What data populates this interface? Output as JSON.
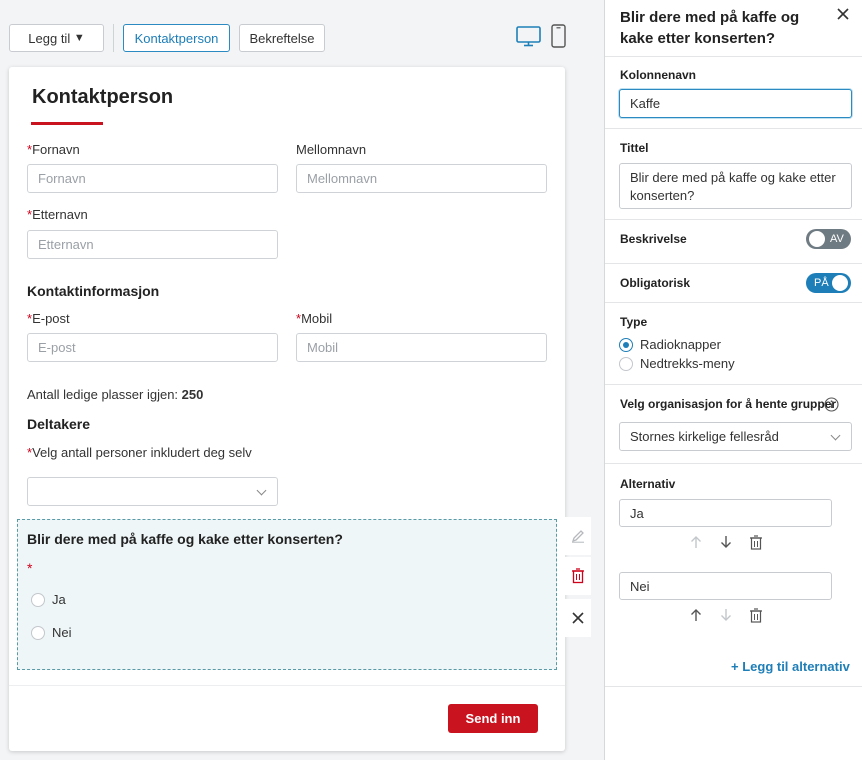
{
  "toolbar": {
    "add_label": "Legg til",
    "add_caret": "▼",
    "tab_contact": "Kontaktperson",
    "tab_confirm": "Bekreftelse",
    "desktop_icon": "desktop-icon",
    "mobile_icon": "mobile-icon"
  },
  "form": {
    "title": "Kontaktperson",
    "required_mark": "*",
    "firstname_label": "Fornavn",
    "firstname_placeholder": "Fornavn",
    "middlename_label": "Mellomnavn",
    "middlename_placeholder": "Mellomnavn",
    "lastname_label": "Etternavn",
    "lastname_placeholder": "Etternavn",
    "contact_section": "Kontaktinformasjon",
    "email_label": "E-post",
    "email_placeholder": "E-post",
    "mobile_label": "Mobil",
    "mobile_placeholder": "Mobil",
    "seats_label": "Antall ledige plasser igjen:",
    "seats_value": "250",
    "participants_section": "Deltakere",
    "participants_label": "Velg antall personer inkludert deg selv",
    "question": "Blir dere med på kaffe og kake etter konserten?",
    "options": [
      "Ja",
      "Nei"
    ],
    "submit": "Send inn"
  },
  "panel": {
    "title": "Blir dere med på kaffe og kake etter konserten?",
    "column_label": "Kolonnenavn",
    "column_value": "Kaffe",
    "title_label": "Tittel",
    "title_value": "Blir dere med på kaffe og kake etter konserten?",
    "description_label": "Beskrivelse",
    "description_toggle": "AV",
    "required_label": "Obligatorisk",
    "required_toggle": "PÅ",
    "type_label": "Type",
    "type_options": [
      "Radioknapper",
      "Nedtrekks-meny"
    ],
    "type_selected": "Radioknapper",
    "org_label": "Velg organisasjon for å hente grupper",
    "org_value": "Stornes kirkelige fellesråd",
    "alternatives_label": "Alternativ",
    "alternatives": [
      "Ja",
      "Nei"
    ],
    "add_alternative": "+ Legg til alternativ"
  },
  "colors": {
    "accent_blue": "#1d7eb8",
    "brand_red": "#c9141f"
  }
}
